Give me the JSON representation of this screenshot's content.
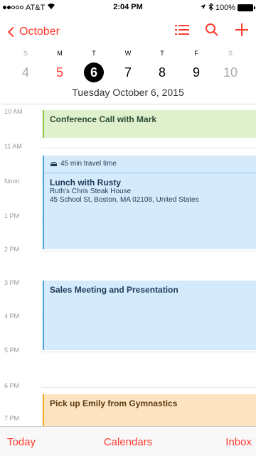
{
  "status": {
    "carrier": "AT&T",
    "time": "2:04 PM",
    "battery": "100%"
  },
  "nav": {
    "back_label": "October"
  },
  "week": {
    "days": [
      {
        "dow": "S",
        "date": "4",
        "kind": "weekend"
      },
      {
        "dow": "M",
        "date": "5",
        "kind": "today"
      },
      {
        "dow": "T",
        "date": "6",
        "kind": "selected"
      },
      {
        "dow": "W",
        "date": "7",
        "kind": "normal"
      },
      {
        "dow": "T",
        "date": "8",
        "kind": "normal"
      },
      {
        "dow": "F",
        "date": "9",
        "kind": "normal"
      },
      {
        "dow": "S",
        "date": "10",
        "kind": "weekend"
      }
    ],
    "selected_title": "Tuesday  October 6, 2015"
  },
  "hours": [
    "10 AM",
    "11 AM",
    "Noon",
    "1 PM",
    "2 PM",
    "3 PM",
    "4 PM",
    "5 PM",
    "6 PM",
    "7 PM"
  ],
  "events": [
    {
      "title": "Conference Call with Mark",
      "color": "green"
    },
    {
      "travel": "45 min travel time",
      "title": "Lunch with Rusty",
      "location_name": "Ruth's Chris Steak House",
      "address": "45 School St, Boston, MA  02108, United States",
      "color": "blue"
    },
    {
      "title": "Sales Meeting and Presentation",
      "color": "blue"
    },
    {
      "title": "Pick up Emily from Gymnastics",
      "color": "orange"
    }
  ],
  "tabbar": {
    "today": "Today",
    "calendars": "Calendars",
    "inbox": "Inbox"
  },
  "colors": {
    "accent": "#ff3b30"
  }
}
